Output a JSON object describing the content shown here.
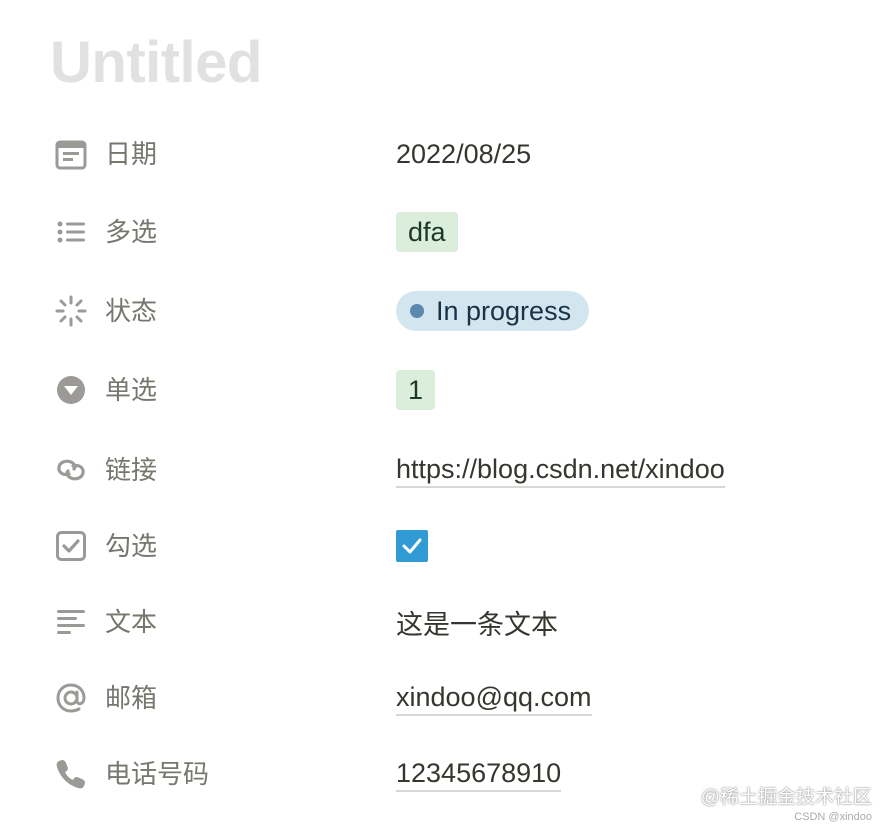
{
  "page": {
    "title": "Untitled"
  },
  "properties": [
    {
      "icon": "calendar-icon",
      "name": "日期",
      "type": "text",
      "value": "2022/08/25"
    },
    {
      "icon": "bullet-list-icon",
      "name": "多选",
      "type": "tag",
      "value": "dfa"
    },
    {
      "icon": "loading-spinner-icon",
      "name": "状态",
      "type": "status",
      "value": "In progress"
    },
    {
      "icon": "dropdown-circle-icon",
      "name": "单选",
      "type": "tag",
      "value": "1"
    },
    {
      "icon": "link-icon",
      "name": "链接",
      "type": "link",
      "value": "https://blog.csdn.net/xindoo"
    },
    {
      "icon": "checkbox-icon",
      "name": "勾选",
      "type": "checkbox",
      "checked": true
    },
    {
      "icon": "text-lines-icon",
      "name": "文本",
      "type": "text",
      "value": "这是一条文本"
    },
    {
      "icon": "at-sign-icon",
      "name": "邮箱",
      "type": "link",
      "value": "xindoo@qq.com"
    },
    {
      "icon": "phone-icon",
      "name": "电话号码",
      "type": "link",
      "value": "12345678910"
    }
  ],
  "watermark": {
    "main": "@稀土掘金技术社区",
    "sub": "CSDN @xindoo"
  },
  "colors": {
    "title": "#e1e1e0",
    "icon": "#9b9a97",
    "tag_bg": "#dbeddb",
    "status_bg": "#d3e5ef",
    "status_dot": "#5e87ad",
    "checkbox": "#2f9ad3"
  }
}
